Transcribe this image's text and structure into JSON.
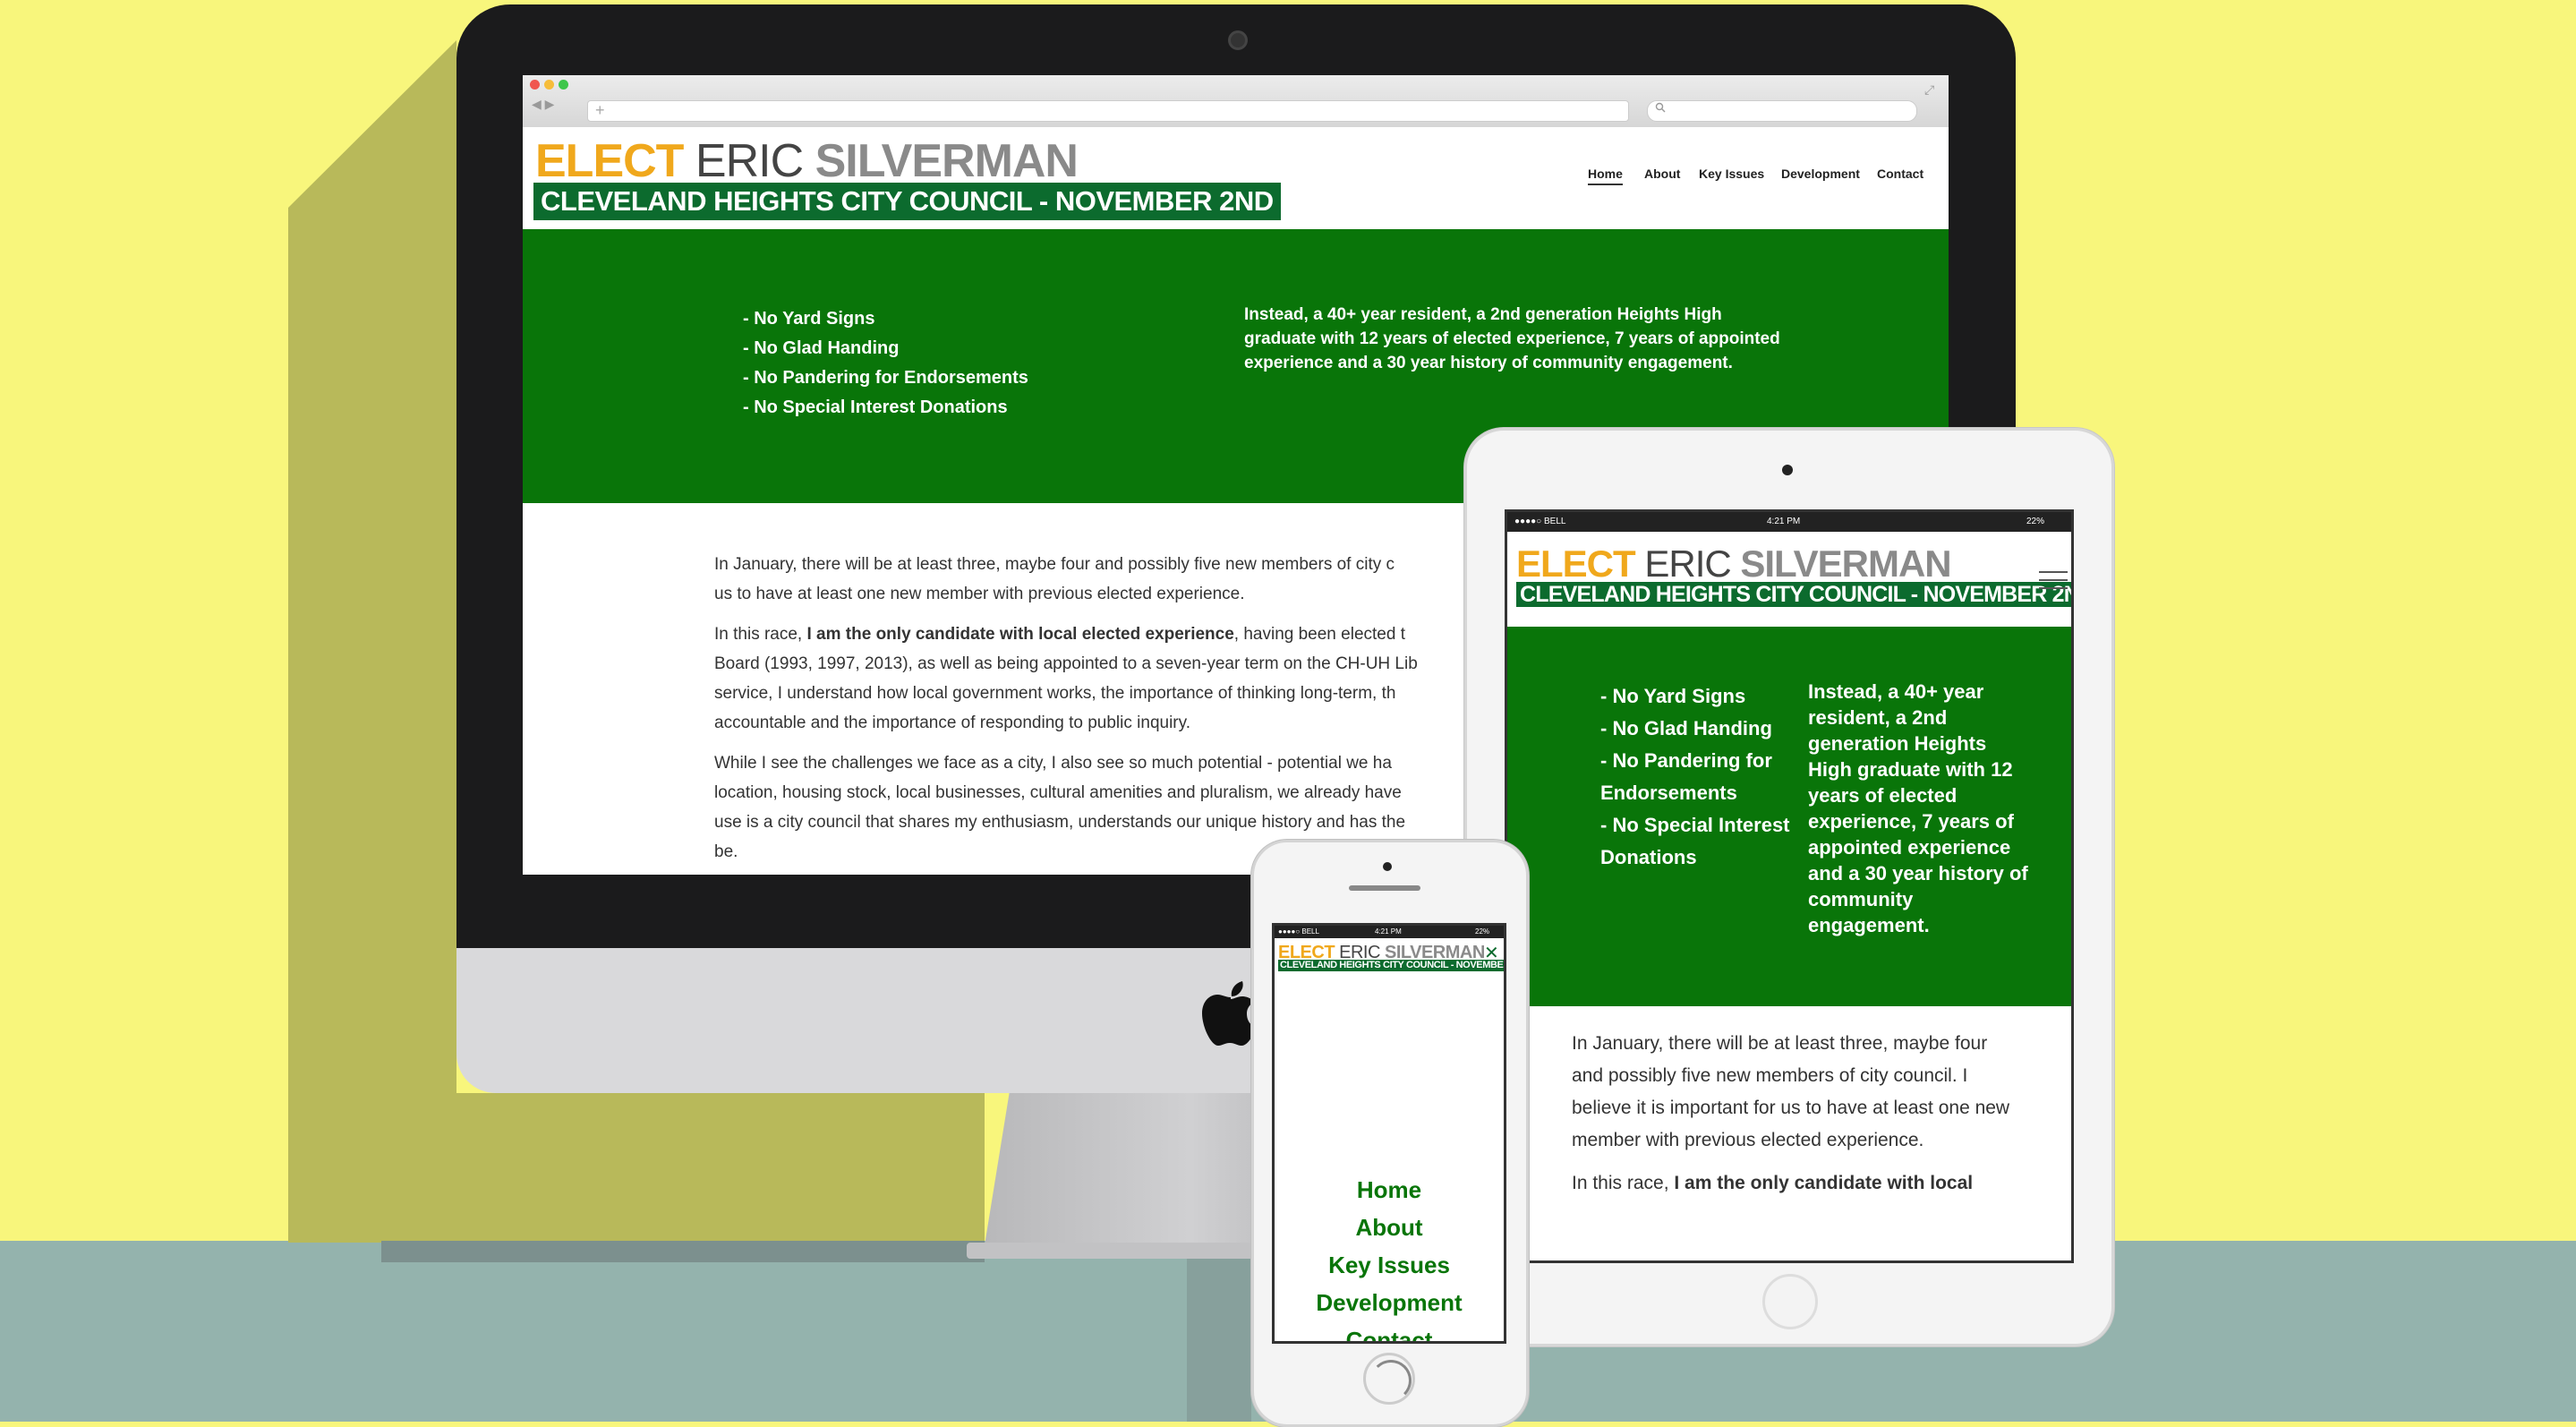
{
  "colors": {
    "background": "#f8f67c",
    "floor": "#94b3ad",
    "accent_orange": "#f0a81c",
    "campaign_green": "#097509",
    "logo_green": "#0c6b2e"
  },
  "site": {
    "logo": {
      "elect": "ELECT",
      "first_name": "ERIC",
      "last_name": "SILVERMAN",
      "tagline": "CLEVELAND HEIGHTS CITY COUNCIL - NOVEMBER 2ND"
    },
    "nav": [
      {
        "label": "Home",
        "active": true
      },
      {
        "label": "About"
      },
      {
        "label": "Key Issues"
      },
      {
        "label": "Development"
      },
      {
        "label": "Contact"
      }
    ],
    "hero": {
      "list": [
        "- No Yard Signs",
        "- No Glad Handing",
        "- No Pandering for Endorsements",
        "- No Special Interest Donations"
      ],
      "statement": "Instead, a 40+ year resident, a 2nd generation Heights High graduate with 12 years of elected experience, 7 years of appointed experience and a 30 year history of community engagement."
    },
    "body": {
      "p1": "In January, there will be at least three, maybe four and possibly five new members of city c",
      "p1_cont": "us to have at least one new member with previous elected experience.",
      "p2_start": "In this race, ",
      "p2_bold": "I am the only candidate with local elected experience",
      "p2_rest": ", having been elected t",
      "p2_l2": "Board (1993, 1997, 2013), as well as being appointed to a seven-year term on the CH-UH Lib",
      "p2_l3": "service, I understand how local government works, the importance of thinking long-term, th",
      "p2_l4": "accountable and the importance of responding to public inquiry.",
      "p3_l1": "While I see the challenges we face as a city, I also see so much potential - potential we ha",
      "p3_l2": "location, housing stock, local businesses, cultural amenities and pluralism, we already have",
      "p3_l3": "use is a city council that shares my enthusiasm, understands our unique history and has the",
      "p3_l4": "be."
    }
  },
  "ipad": {
    "status": {
      "carrier": "●●●●○ BELL",
      "time": "4:21 PM",
      "battery": "22%"
    },
    "list": [
      "- No Yard Signs",
      "- No Glad Handing",
      "- No Pandering for Endorsements",
      "- No Special Interest Donations"
    ],
    "statement": "Instead, a 40+ year resident, a 2nd generation Heights High graduate with 12 years of elected experience, 7 years of appointed experience and a 30 year history of community engagement.",
    "body_p1": "In January, there will be at least three, maybe four and possibly five new members of city council. I believe it is important for us to have at least one new member with previous elected experience.",
    "body_p2_start": "In this race, ",
    "body_p2_bold": "I am the only candidate with local"
  },
  "iphone": {
    "status": {
      "carrier": "●●●●○ BELL",
      "time": "4:21 PM",
      "battery": "22%"
    },
    "close_icon": "close-icon",
    "menu": [
      "Home",
      "About",
      "Key Issues",
      "Development",
      "Contact"
    ]
  }
}
